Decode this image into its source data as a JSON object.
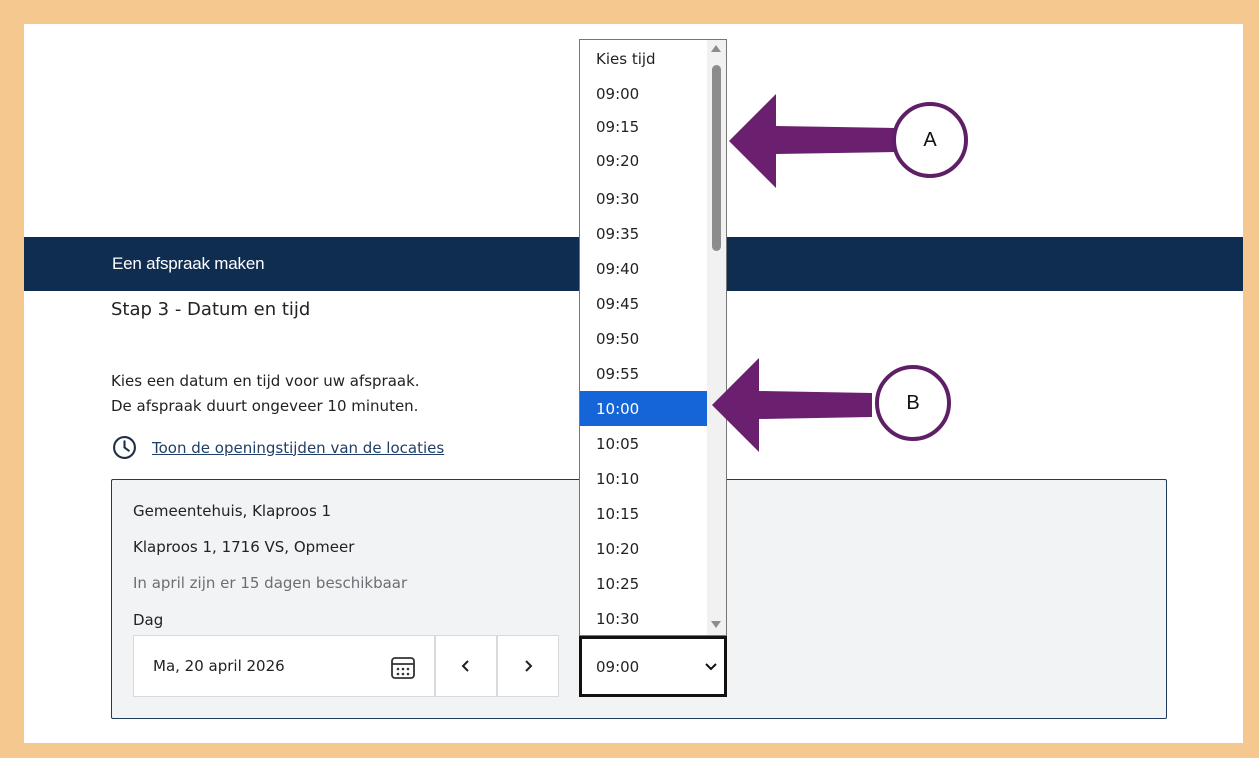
{
  "banner": {
    "title": "Een afspraak maken"
  },
  "step": {
    "title": "Stap 3 - Datum en tijd"
  },
  "intro": {
    "line1": "Kies een datum en tijd voor uw afspraak.",
    "line2": "De afspraak duurt ongeveer 10 minuten."
  },
  "opening_hours": {
    "link_label": "Toon de openingstijden van de locaties",
    "icon": "clock-icon"
  },
  "location": {
    "name": "Gemeentehuis, Klaproos 1",
    "address": "Klaproos 1, 1716 VS, Opmeer",
    "availability": "In april zijn er 15 dagen beschikbaar"
  },
  "day": {
    "label": "Dag",
    "value": "Ma, 20 april 2026",
    "prev_icon": "chevron-left-icon",
    "next_icon": "chevron-right-icon",
    "prev_label": "‹",
    "next_label": "›"
  },
  "time_select": {
    "selected_value": "09:00",
    "options": [
      "Kies tijd",
      "09:00",
      "09:15",
      "09:20",
      "09:30",
      "09:35",
      "09:40",
      "09:45",
      "09:50",
      "09:55",
      "10:00",
      "10:05",
      "10:10",
      "10:15",
      "10:20",
      "10:25",
      "10:30"
    ],
    "highlighted_option": "10:00"
  },
  "annotations": {
    "a_label": "A",
    "b_label": "B",
    "color": "#6a1f6f"
  },
  "colors": {
    "banner": "#0f2d50",
    "frame": "#f5c890",
    "highlight": "#1565d8"
  }
}
